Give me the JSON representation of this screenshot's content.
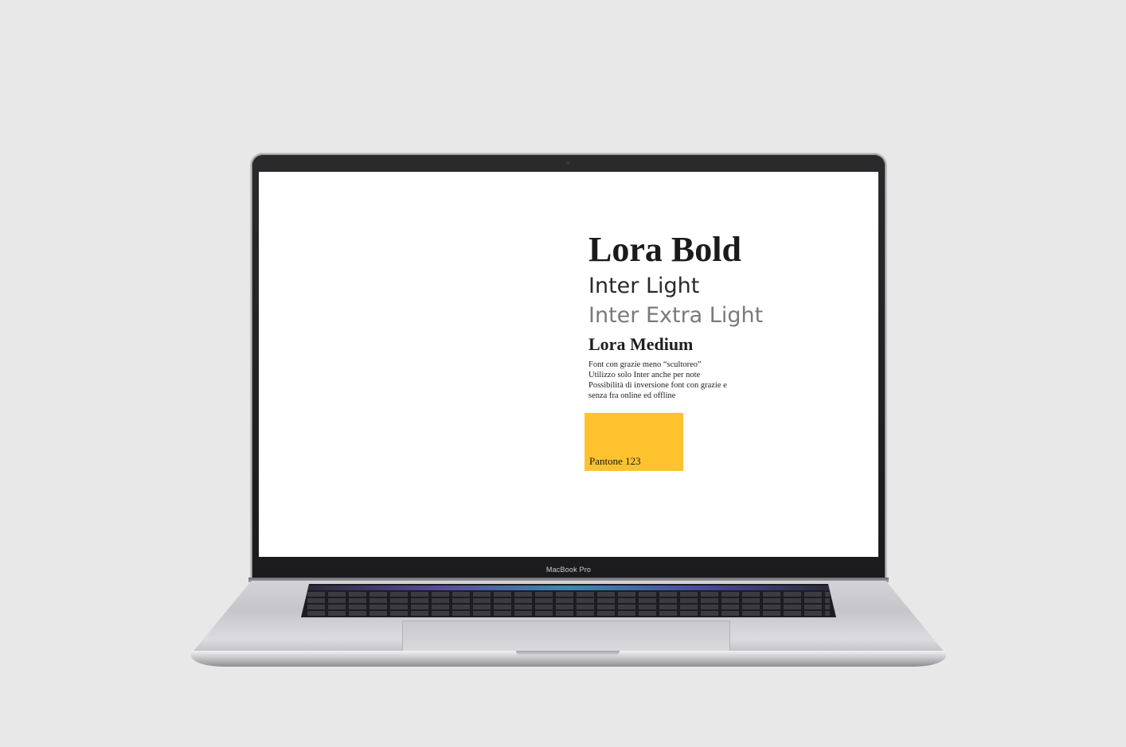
{
  "device": {
    "bezel_label": "MacBook Pro"
  },
  "screen": {
    "fonts": {
      "heading_bold": "Lora Bold",
      "sans_light": "Inter Light",
      "sans_extra_light": "Inter Extra Light",
      "heading_medium": "Lora Medium"
    },
    "notes": [
      "Font con grazie meno “scultoreo”",
      "Utilizzo solo Inter anche per note",
      "Possibilità di inversione font con grazie e",
      "senza fra online ed offline"
    ],
    "swatch": {
      "label": "Pantone  123",
      "color": "#fec22e"
    }
  },
  "colors": {
    "background": "#e8e8e8",
    "screen": "#ffffff",
    "bezel": "#1b1b1d"
  }
}
